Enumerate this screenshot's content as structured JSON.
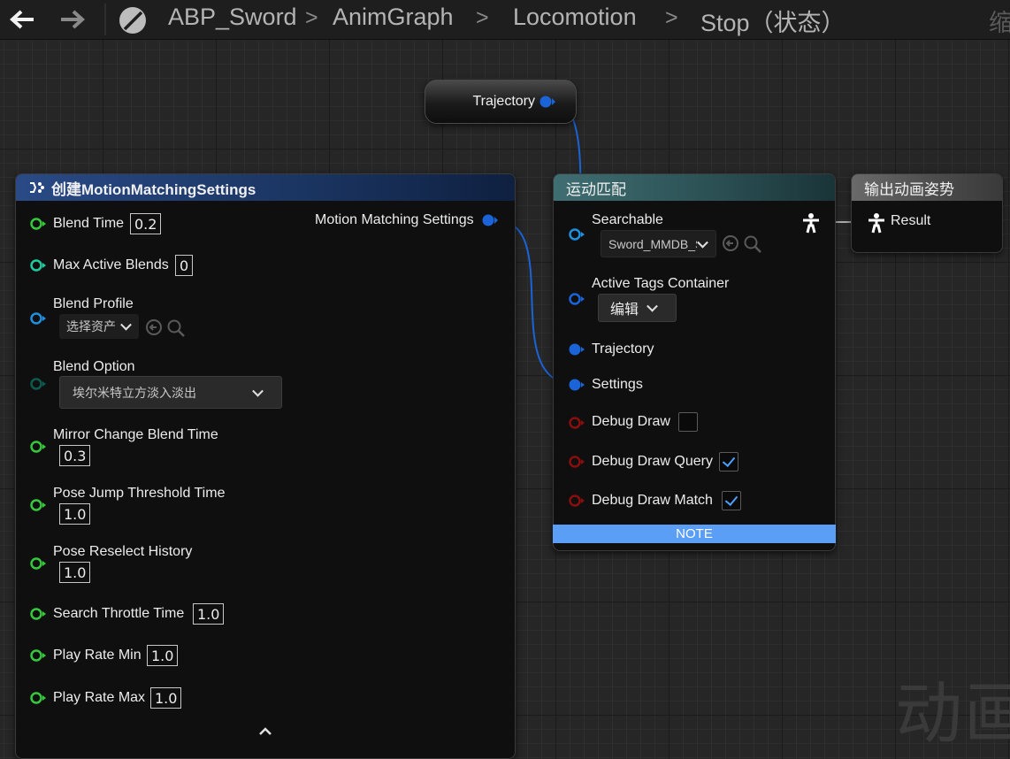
{
  "breadcrumb": {
    "items": [
      "ABP_Sword",
      "AnimGraph",
      "Locomotion",
      "Stop（状态）"
    ],
    "separator": ">",
    "cutoff_text": "缩"
  },
  "watermark_text": "动画",
  "trajectory_node": {
    "label": "Trajectory"
  },
  "make_node": {
    "title": "创建MotionMatchingSettings",
    "output_label": "Motion Matching Settings",
    "fields": {
      "blend_time": {
        "label": "Blend Time",
        "value": "0.2"
      },
      "max_active_blends": {
        "label": "Max Active Blends",
        "value": "0"
      },
      "blend_profile": {
        "label": "Blend Profile",
        "value": "选择资产"
      },
      "blend_option": {
        "label": "Blend Option",
        "value": "埃尔米特立方淡入淡出"
      },
      "mirror_change_blend_time": {
        "label": "Mirror Change Blend Time",
        "value": "0.3"
      },
      "pose_jump_threshold_time": {
        "label": "Pose Jump Threshold Time",
        "value": "1.0"
      },
      "pose_reselect_history": {
        "label": "Pose Reselect History",
        "value": "1.0"
      },
      "search_throttle_time": {
        "label": "Search Throttle Time",
        "value": "1.0"
      },
      "play_rate_min": {
        "label": "Play Rate Min",
        "value": "1.0"
      },
      "play_rate_max": {
        "label": "Play Rate Max",
        "value": "1.0"
      }
    }
  },
  "mm_node": {
    "title": "运动匹配",
    "searchable": {
      "label": "Searchable",
      "value": "Sword_MMDB_S"
    },
    "active_tags": {
      "label": "Active Tags Container",
      "value": "编辑"
    },
    "trajectory": {
      "label": "Trajectory"
    },
    "settings": {
      "label": "Settings"
    },
    "debug_draw": {
      "label": "Debug Draw",
      "checked": false
    },
    "debug_draw_query": {
      "label": "Debug Draw Query",
      "checked": true
    },
    "debug_draw_match": {
      "label": "Debug Draw Match",
      "checked": true
    },
    "note": "NOTE"
  },
  "output_node": {
    "title": "输出动画姿势",
    "result_label": "Result"
  },
  "colors": {
    "float_pin": "#35c93c",
    "int_pin": "#1ecca0",
    "object_pin": "#1f8fe0",
    "enum_pin": "#0d5a4e",
    "bool_pin": "#8a0e0e",
    "struct_pin": "#1a64d8",
    "note_bar": "#5a9ef5"
  }
}
